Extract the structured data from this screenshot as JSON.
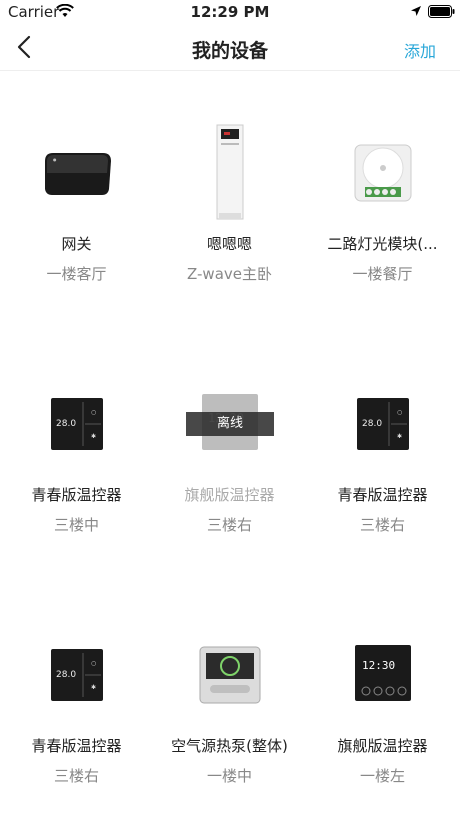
{
  "status_bar": {
    "carrier": "Carrier",
    "time": "12:29 PM"
  },
  "nav": {
    "title": "我的设备",
    "add_label": "添加"
  },
  "devices": [
    {
      "name": "网关",
      "room": "一楼客厅",
      "icon": "gateway-device-icon",
      "offline": false
    },
    {
      "name": "嗯嗯嗯",
      "room": "Z-wave主卧",
      "icon": "heat-pump-unit-icon",
      "offline": false
    },
    {
      "name": "二路灯光模块(...",
      "room": "一楼餐厅",
      "icon": "light-module-icon",
      "offline": false
    },
    {
      "name": "青春版温控器",
      "room": "三楼中",
      "icon": "thermostat-icon",
      "offline": false
    },
    {
      "name": "旗舰版温控器",
      "room": "三楼右",
      "icon": "flagship-thermostat-icon",
      "offline": true,
      "offline_label": "离线"
    },
    {
      "name": "青春版温控器",
      "room": "三楼右",
      "icon": "thermostat-icon",
      "offline": false
    },
    {
      "name": "青春版温控器",
      "room": "三楼右",
      "icon": "thermostat-icon",
      "offline": false
    },
    {
      "name": "空气源热泵(整体)",
      "room": "一楼中",
      "icon": "air-heat-pump-controller-icon",
      "offline": false
    },
    {
      "name": "旗舰版温控器",
      "room": "一楼左",
      "icon": "flagship-thermostat-icon",
      "offline": false
    }
  ],
  "thermostat_display": {
    "setpoint": "28.0",
    "clock": "12:30"
  },
  "colors": {
    "accent": "#2aa7d8"
  }
}
